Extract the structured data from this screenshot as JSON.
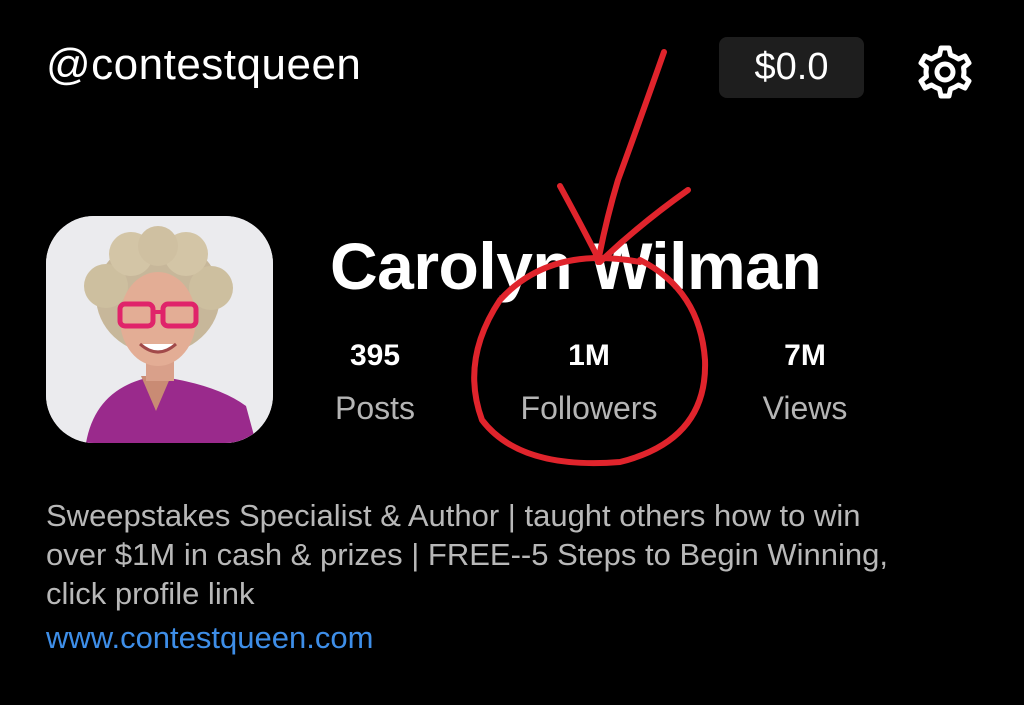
{
  "header": {
    "handle": "@contestqueen",
    "balance": "$0.0",
    "settings_icon": "gear-icon"
  },
  "profile": {
    "name": "Carolyn Wilman",
    "stats": [
      {
        "value": "395",
        "label": "Posts"
      },
      {
        "value": "1M",
        "label": "Followers"
      },
      {
        "value": "7M",
        "label": "Views"
      }
    ],
    "bio_lines": [
      "Sweepstakes Specialist & Author | taught others how to win",
      "over $1M in cash & prizes | FREE--5 Steps to Begin Winning,",
      "click profile link"
    ],
    "link": "www.contestqueen.com"
  },
  "colors": {
    "background": "#000000",
    "link": "#3e8ee8",
    "annotation": "#e0242c",
    "balance_pill": "#1e1e1e"
  }
}
